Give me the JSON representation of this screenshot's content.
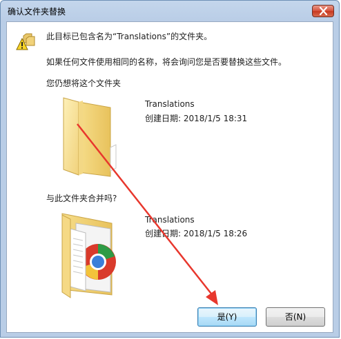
{
  "window": {
    "title": "确认文件夹替换"
  },
  "message": {
    "line1": "此目标已包含名为“Translations”的文件夹。",
    "line2": "如果任何文件使用相同的名称，将会询问您是否要替换这些文件。",
    "line3": "您仍想将这个文件夹"
  },
  "existing_folder": {
    "name": "Translations",
    "created": "创建日期: 2018/1/5 18:31"
  },
  "merge_prompt": "与此文件夹合并吗?",
  "new_folder": {
    "name": "Translations",
    "created": "创建日期: 2018/1/5 18:26"
  },
  "buttons": {
    "yes": "是(Y)",
    "no": "否(N)"
  },
  "icons": {
    "warning": "warning-icon",
    "close": "close-icon",
    "folder": "folder-icon",
    "folder_with_files": "folder-with-files-icon"
  },
  "colors": {
    "annotation_arrow": "#e8372d",
    "title_bar": "#b9cde6",
    "close_button": "#c8381f"
  }
}
